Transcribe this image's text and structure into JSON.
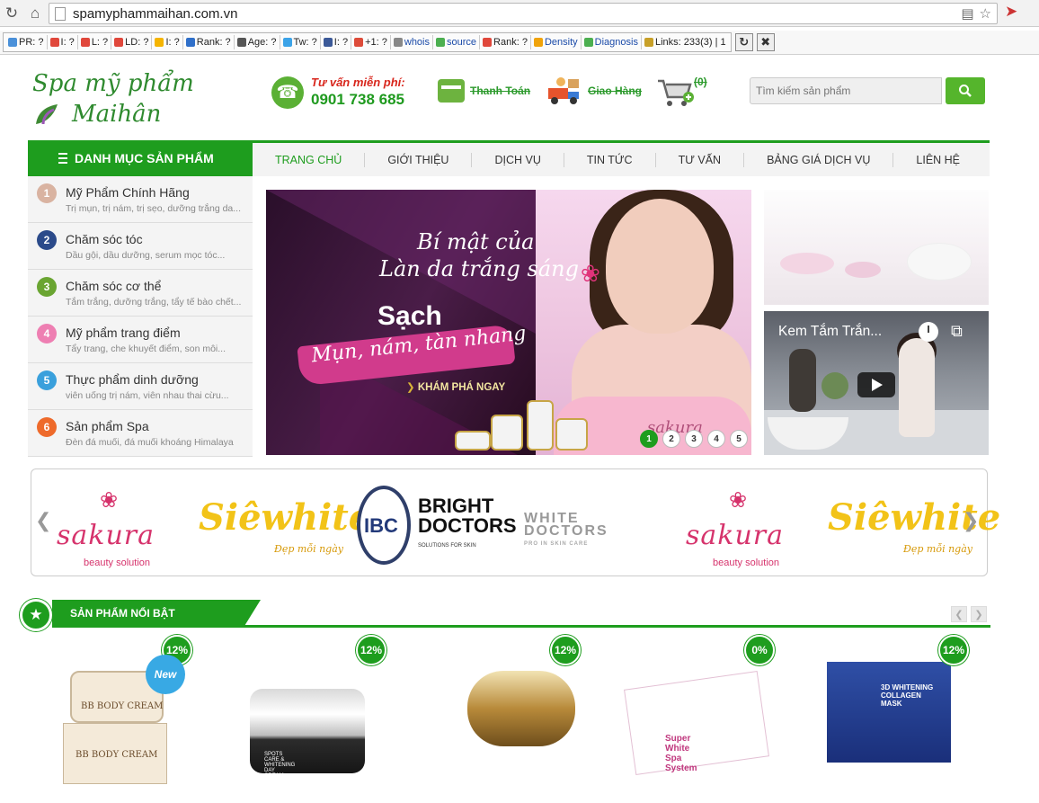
{
  "browser": {
    "url": "spamyphammaihan.com.vn",
    "seo_items": [
      {
        "label": "PR: ?",
        "color": "#4a90d9"
      },
      {
        "label": "I: ?",
        "color": "#e0473b"
      },
      {
        "label": "L: ?",
        "color": "#e0473b"
      },
      {
        "label": "LD: ?",
        "color": "#e0473b"
      },
      {
        "label": "I: ?",
        "color": "#f5b400"
      },
      {
        "label": "Rank: ?",
        "color": "#2f6fc9"
      },
      {
        "label": "Age: ?",
        "color": "#555555"
      },
      {
        "label": "Tw: ?",
        "color": "#3ba3e8"
      },
      {
        "label": "I: ?",
        "color": "#3b5998"
      },
      {
        "label": "+1: ?",
        "color": "#dd4b39"
      },
      {
        "label": "whois",
        "color": "#888888"
      },
      {
        "label": "source",
        "color": "#4caf50"
      },
      {
        "label": "Rank: ?",
        "color": "#e0473b"
      },
      {
        "label": "Density",
        "color": "#f0a30a"
      },
      {
        "label": "Diagnosis",
        "color": "#4caf50"
      },
      {
        "label": "Links: 233(3) | 1",
        "color": "#c8a028"
      }
    ]
  },
  "header": {
    "logo_line1": "Spa mỹ phẩm",
    "logo_line2": "Maihân",
    "hotline_label": "Tư vấn miễn phí:",
    "hotline_number": "0901 738 685",
    "payment_label": "Thanh Toán",
    "delivery_label": "Giao Hàng",
    "cart_count": "(0)",
    "search_placeholder": "Tìm kiếm sản phẩm"
  },
  "nav": {
    "category_title": "DANH MỤC SẢN PHẨM",
    "items": [
      "TRANG CHỦ",
      "GIỚI THIỆU",
      "DỊCH VỤ",
      "TIN TỨC",
      "TƯ VẤN",
      "BẢNG GIÁ DỊCH VỤ",
      "LIÊN HỆ"
    ]
  },
  "categories": [
    {
      "num": "1",
      "title": "Mỹ Phẩm Chính Hãng",
      "sub": "Trị mụn, trị nám, trị sẹo, dưỡng trắng da...",
      "color": "#d9b3a1"
    },
    {
      "num": "2",
      "title": "Chăm sóc tóc",
      "sub": "Dầu gội, dầu dưỡng, serum mọc tóc...",
      "color": "#2b4a8a"
    },
    {
      "num": "3",
      "title": "Chăm sóc cơ thể",
      "sub": "Tắm trắng, dưỡng trắng, tẩy tế bào chết...",
      "color": "#6aa532"
    },
    {
      "num": "4",
      "title": "Mỹ phẩm trang điểm",
      "sub": "Tẩy trang, che khuyết điểm, son môi...",
      "color": "#ee7fb2"
    },
    {
      "num": "5",
      "title": "Thực phẩm dinh dưỡng",
      "sub": "viên uống trị nám, viên nhau thai cừu...",
      "color": "#3aa0dc"
    },
    {
      "num": "6",
      "title": "Sản phẩm Spa",
      "sub": "Đèn đá muối, đá muối khoáng Himalaya",
      "color": "#ee6a2b"
    }
  ],
  "banner": {
    "script1": "Bí mật của",
    "script2": "Làn da trắng sáng",
    "headline": "Sạch",
    "tagline": "Mụn, nám, tàn nhang",
    "cta": "KHÁM PHÁ NGAY",
    "brand": "sakura",
    "slides": [
      "1",
      "2",
      "3",
      "4",
      "5"
    ],
    "active_slide": "1"
  },
  "video": {
    "title": "Kem Tắm Trắn..."
  },
  "brands": {
    "sakura_name": "sakura",
    "sakura_tag": "beauty solution",
    "white_name": "Siêwhite",
    "white_tag": "Đẹp mỗi ngày",
    "ibc": "IBC",
    "bright_line1": "BRIGHT",
    "bright_line2": "DOCTORS",
    "bright_small": "SOLUTIONS FOR SKIN",
    "wd_line1": "WHITE",
    "wd_line2": "DOCTORS",
    "wd_small": "PRO IN SKIN CARE"
  },
  "featured": {
    "title": "SẢN PHẨM NỔI BẬT",
    "new_tag": "New",
    "products": [
      {
        "discount": "12%",
        "label1": "BB BODY CREAM",
        "label2": "BB BODY CREAM"
      },
      {
        "discount": "12%",
        "label1": "SPOTS CARE & WHITENING DAY CREAM"
      },
      {
        "discount": "12%"
      },
      {
        "discount": "0%",
        "label1": "Super White Spa System"
      },
      {
        "discount": "12%",
        "label1": "3D WHITENING COLLAGEN MASK"
      }
    ]
  }
}
